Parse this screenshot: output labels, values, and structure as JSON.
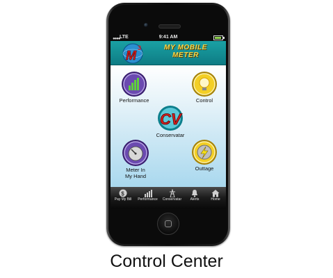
{
  "status_bar": {
    "carrier": "LTE",
    "time": "9:41 AM"
  },
  "header": {
    "title_line1": "MY MOBILE",
    "title_line2": "METER",
    "logo_text": "M",
    "logo_superscript": "3"
  },
  "tiles": {
    "performance": {
      "label": "Performance",
      "icon": "bar-chart-icon"
    },
    "control": {
      "label": "Control",
      "icon": "bulb-icon"
    },
    "conservatar": {
      "label": "Conservatar",
      "icon": "cv-logo-icon",
      "logo_text": "CV"
    },
    "meter": {
      "label_line1": "Meter In",
      "label_line2": "My Hand",
      "icon": "speedometer-icon"
    },
    "outage": {
      "label": "Outtage",
      "icon": "lightning-icon"
    }
  },
  "tabs": [
    {
      "label": "Pay My Bill",
      "icon": "dollar-icon"
    },
    {
      "label": "Performance",
      "icon": "bar-chart-icon"
    },
    {
      "label": "Conservatar",
      "icon": "tower-icon"
    },
    {
      "label": "Alerts",
      "icon": "bell-icon"
    },
    {
      "label": "Home",
      "icon": "home-icon"
    }
  ],
  "caption": "Control Center",
  "colors": {
    "header": "#1aa1a4",
    "title": "#f4d64a",
    "tile_purple": "#4a2a8a",
    "tile_yellow": "#e9c21a",
    "tile_red": "#d6211f"
  }
}
